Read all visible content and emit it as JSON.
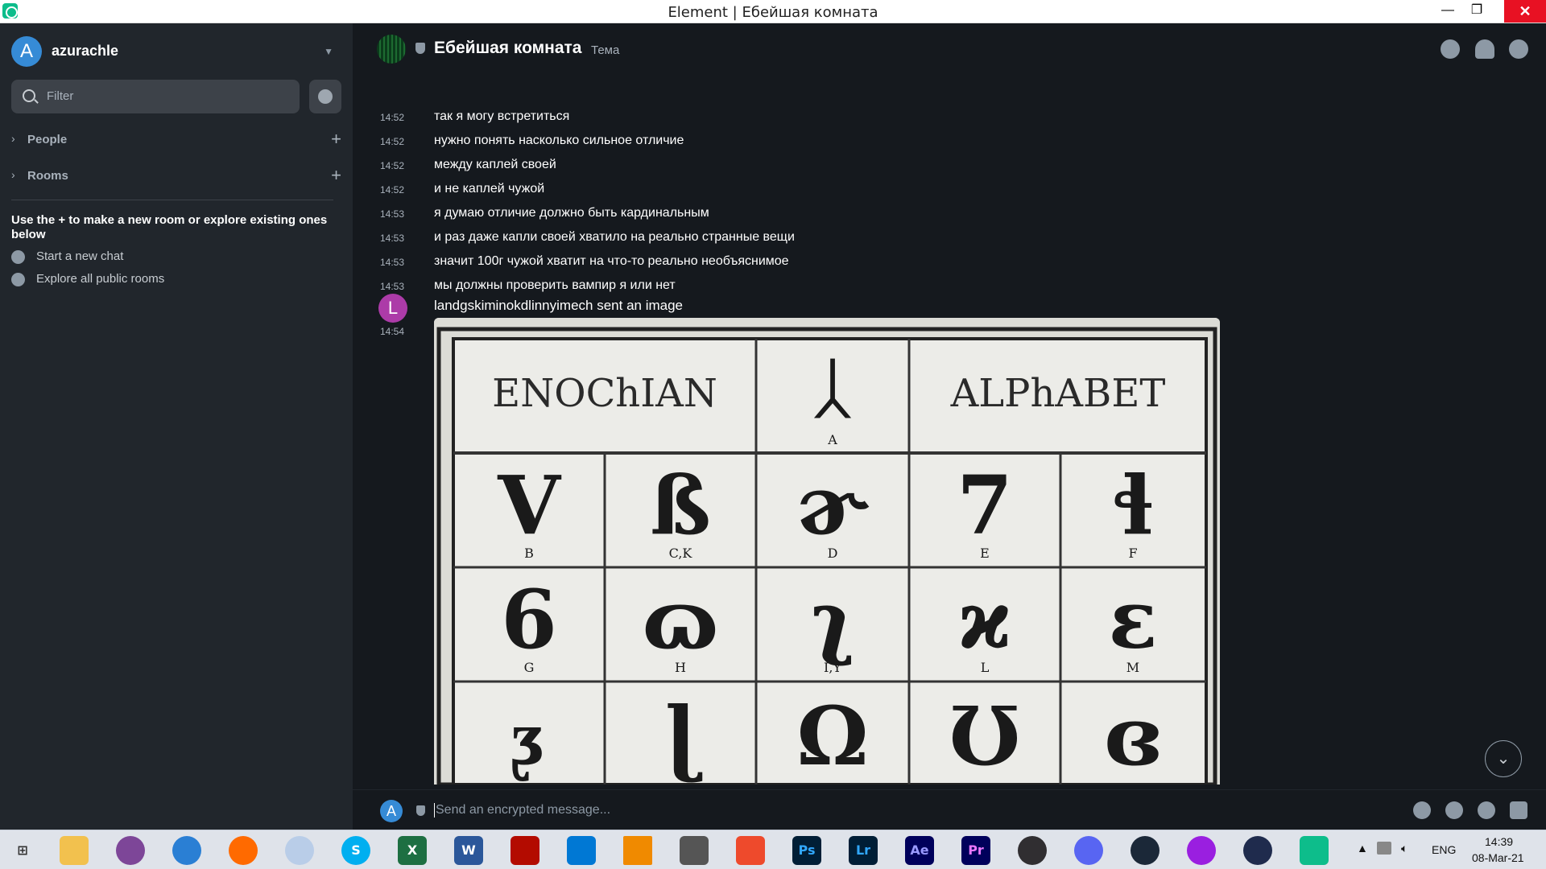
{
  "window": {
    "title": "Element | Ебейшая комната",
    "minimize": "—",
    "maximize": "❐",
    "close": "✕"
  },
  "sidebar": {
    "user_initial": "A",
    "user_name": "azurachle",
    "filter_placeholder": "Filter",
    "sections": [
      {
        "label": "People"
      },
      {
        "label": "Rooms"
      }
    ],
    "hint": "Use the + to make a new room or explore existing ones below",
    "links": [
      {
        "label": "Start a new chat"
      },
      {
        "label": "Explore all public rooms"
      }
    ]
  },
  "room": {
    "name": "Ебейшая комната",
    "topic": "Тема"
  },
  "messages": [
    {
      "time": "14:52",
      "text": "так я могу встретиться"
    },
    {
      "time": "14:52",
      "text": "нужно понять насколько сильное отличие"
    },
    {
      "time": "14:52",
      "text": "между каплей своей"
    },
    {
      "time": "14:52",
      "text": "и не каплей чужой"
    },
    {
      "time": "14:53",
      "text": "я думаю отличие должно быть кардинальным"
    },
    {
      "time": "14:53",
      "text": "и раз даже капли своей хватило на реально странные вещи"
    },
    {
      "time": "14:53",
      "text": "значит 100г чужой хватит на что-то реально необъяснимое"
    },
    {
      "time": "14:53",
      "text": "мы должны проверить вампир я или нет"
    }
  ],
  "image_event": {
    "avatar_initial": "L",
    "time": "14:54",
    "text": "landgskiminokdlinnyimech sent an image",
    "image_title_left": "ENOChIAN",
    "image_title_right": "ALPhABET",
    "image_letters": [
      "A",
      "B",
      "C,K",
      "D",
      "E",
      "F",
      "G",
      "H",
      "I,Y",
      "L",
      "M"
    ]
  },
  "composer": {
    "avatar_initial": "A",
    "placeholder": "Send an encrypted message..."
  },
  "taskbar": {
    "apps": [
      "windows-start",
      "file-explorer",
      "tor-browser",
      "browser",
      "firefox",
      "app-circle",
      "skype",
      "excel",
      "word",
      "acrobat",
      "vscode",
      "vlc",
      "downloader",
      "smartgit",
      "photoshop",
      "lightroom",
      "after-effects",
      "premiere",
      "obs",
      "discord",
      "steam",
      "opera",
      "vpn",
      "element"
    ],
    "labels": {
      "skype": "S",
      "excel": "X",
      "word": "W",
      "photoshop": "Ps",
      "lightroom": "Lr",
      "after_effects": "Ae",
      "premiere": "Pr"
    },
    "language": "ENG",
    "time": "14:39",
    "date": "08-Mar-21"
  },
  "colors": {
    "accent": "#0dbd8b",
    "sidebar": "#21262c",
    "timeline": "#15191e",
    "user_avatar": "#368bd6",
    "sender_avatar": "#ac3ba8"
  }
}
